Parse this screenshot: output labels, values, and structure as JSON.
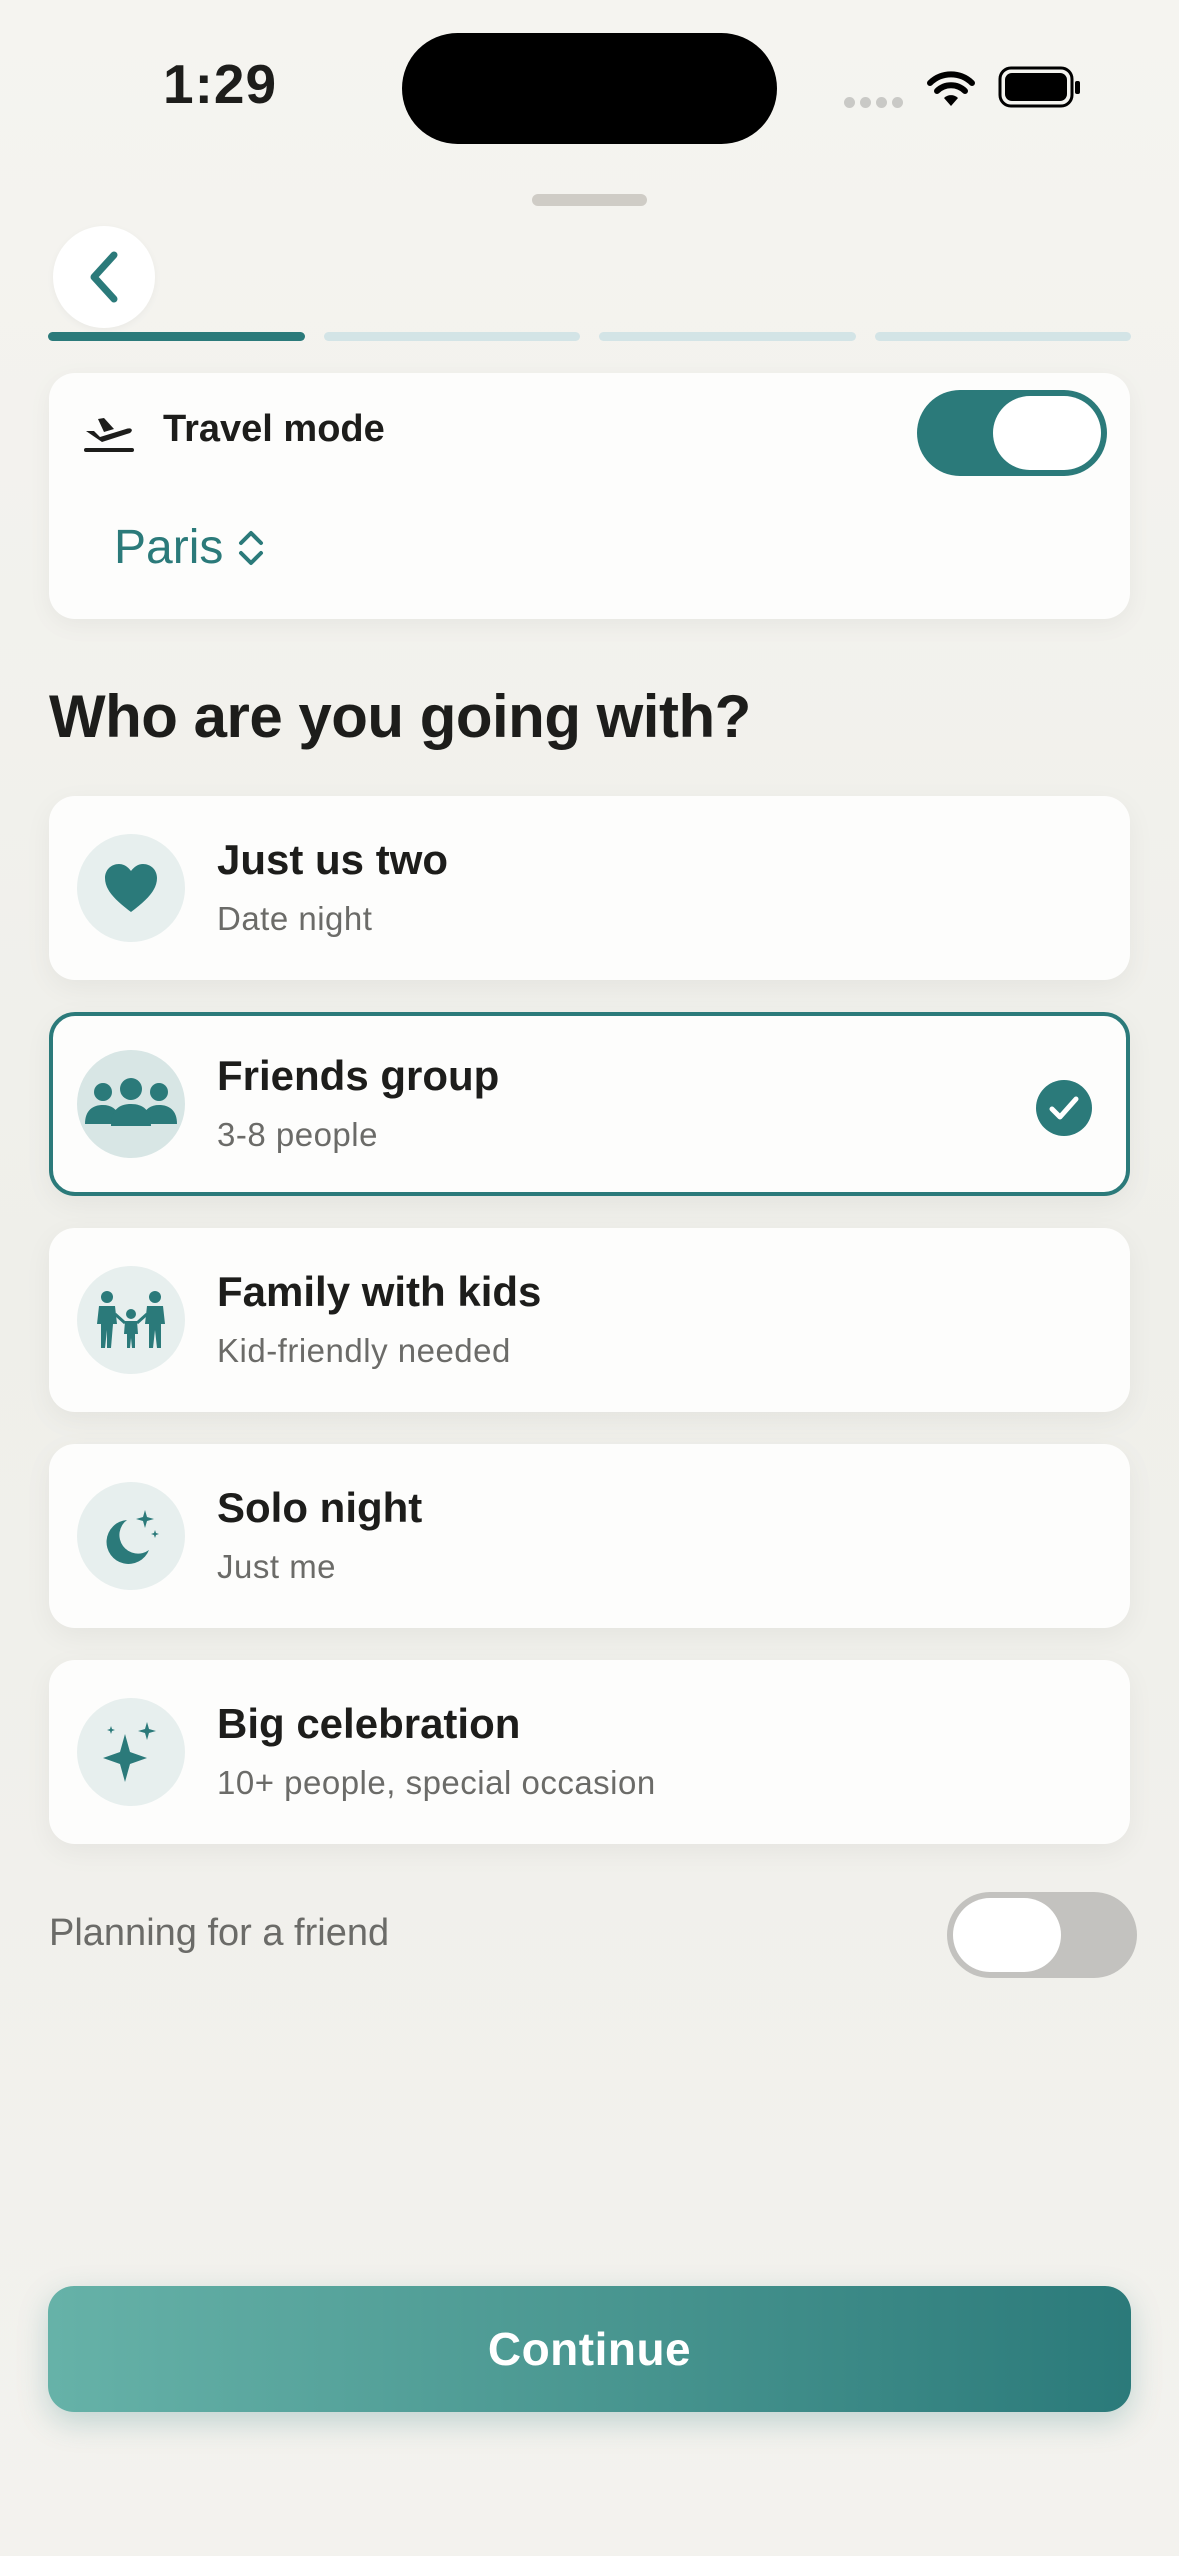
{
  "status_bar": {
    "time": "1:29"
  },
  "header": {
    "back_icon": "chevron-left-icon",
    "progress_steps": 4,
    "current_step": 1
  },
  "travel_mode": {
    "label": "Travel mode",
    "enabled": true,
    "city": "Paris"
  },
  "question": "Who are you going with?",
  "options": [
    {
      "title": "Just us two",
      "subtitle": "Date night",
      "icon": "heart-icon",
      "selected": false
    },
    {
      "title": "Friends group",
      "subtitle": "3-8 people",
      "icon": "group-icon",
      "selected": true
    },
    {
      "title": "Family with kids",
      "subtitle": "Kid-friendly needed",
      "icon": "family-icon",
      "selected": false
    },
    {
      "title": "Solo night",
      "subtitle": "Just me",
      "icon": "moon-stars-icon",
      "selected": false
    },
    {
      "title": "Big celebration",
      "subtitle": "10+ people, special occasion",
      "icon": "sparkles-icon",
      "selected": false
    }
  ],
  "planning_for_friend": {
    "label": "Planning for a friend",
    "enabled": false
  },
  "continue_label": "Continue",
  "colors": {
    "accent": "#2b7a7a",
    "background": "#f3f2ee",
    "card": "#fdfdfc"
  }
}
